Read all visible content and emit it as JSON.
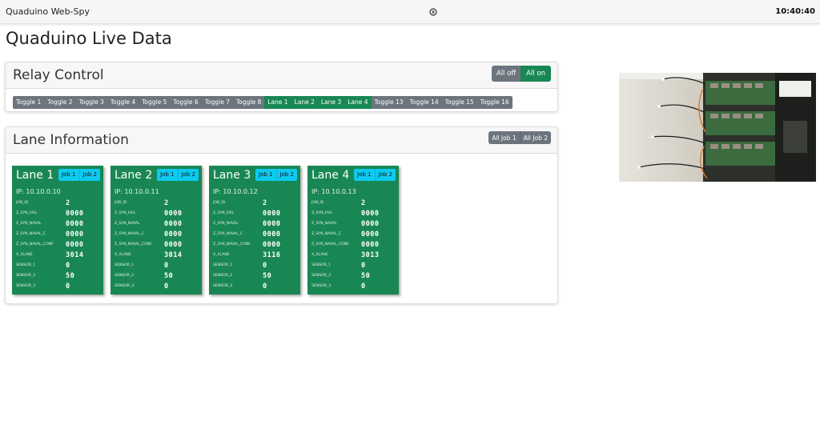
{
  "topbar": {
    "title": "Quaduino Web-Spy",
    "clock": "10:40:40"
  },
  "page": {
    "title": "Quaduino Live Data"
  },
  "relay": {
    "title": "Relay Control",
    "all_off": "All off",
    "all_on": "All on",
    "toggles": [
      {
        "label": "Toggle 1",
        "state": "off"
      },
      {
        "label": "Toggle 2",
        "state": "off"
      },
      {
        "label": "Toggle 3",
        "state": "off"
      },
      {
        "label": "Toggle 4",
        "state": "off"
      },
      {
        "label": "Toggle 5",
        "state": "off"
      },
      {
        "label": "Toggle 6",
        "state": "off"
      },
      {
        "label": "Toggle 7",
        "state": "off"
      },
      {
        "label": "Toggle 8",
        "state": "off"
      },
      {
        "label": "Lane 1",
        "state": "on"
      },
      {
        "label": "Lane 2",
        "state": "on"
      },
      {
        "label": "Lane 3",
        "state": "on"
      },
      {
        "label": "Lane 4",
        "state": "on"
      },
      {
        "label": "Toggle 13",
        "state": "off"
      },
      {
        "label": "Toggle 14",
        "state": "off"
      },
      {
        "label": "Toggle 15",
        "state": "off"
      },
      {
        "label": "Toggle 16",
        "state": "off"
      }
    ]
  },
  "lanes_panel": {
    "title": "Lane Information",
    "all_job1": "All Job 1",
    "all_job2": "All Job 2",
    "job1_label": "Job 1",
    "job2_label": "Job 2",
    "lanes": [
      {
        "title": "Lane 1",
        "ip": "IP: 10.10.0.10",
        "fields": [
          {
            "k": "JOB_ID",
            "v": "2"
          },
          {
            "k": "Z_SYN_FAIL",
            "v": "0000"
          },
          {
            "k": "Z_SYN_NAVAL",
            "v": "0000"
          },
          {
            "k": "Z_SYN_NAVAL_C",
            "v": "0000"
          },
          {
            "k": "Z_SYN_NAVAL_CONF",
            "v": "0000"
          },
          {
            "k": "X_XLANE",
            "v": "3014"
          },
          {
            "k": "SENSOR_1",
            "v": "0"
          },
          {
            "k": "SENSOR_2",
            "v": "50"
          },
          {
            "k": "SENSOR_3",
            "v": "0"
          }
        ]
      },
      {
        "title": "Lane 2",
        "ip": "IP: 10.10.0.11",
        "fields": [
          {
            "k": "JOB_ID",
            "v": "2"
          },
          {
            "k": "Z_SYN_FAIL",
            "v": "0000"
          },
          {
            "k": "Z_SYN_NAVAL",
            "v": "0000"
          },
          {
            "k": "Z_SYN_NAVAL_C",
            "v": "0000"
          },
          {
            "k": "Z_SYN_NAVAL_CONF",
            "v": "0000"
          },
          {
            "k": "X_XLANE",
            "v": "3014"
          },
          {
            "k": "SENSOR_1",
            "v": "0"
          },
          {
            "k": "SENSOR_2",
            "v": "50"
          },
          {
            "k": "SENSOR_3",
            "v": "0"
          }
        ]
      },
      {
        "title": "Lane 3",
        "ip": "IP: 10.10.0.12",
        "fields": [
          {
            "k": "JOB_ID",
            "v": "2"
          },
          {
            "k": "Z_SYN_FAIL",
            "v": "0000"
          },
          {
            "k": "Z_SYN_NAVAL",
            "v": "0000"
          },
          {
            "k": "Z_SYN_NAVAL_C",
            "v": "0000"
          },
          {
            "k": "Z_SYN_NAVAL_CONF",
            "v": "0000"
          },
          {
            "k": "X_XLANE",
            "v": "3116"
          },
          {
            "k": "SENSOR_1",
            "v": "0"
          },
          {
            "k": "SENSOR_2",
            "v": "50"
          },
          {
            "k": "SENSOR_3",
            "v": "0"
          }
        ]
      },
      {
        "title": "Lane 4",
        "ip": "IP: 10.10.0.13",
        "fields": [
          {
            "k": "JOB_ID",
            "v": "2"
          },
          {
            "k": "Z_SYN_FAIL",
            "v": "0000"
          },
          {
            "k": "Z_SYN_NAVAL",
            "v": "0000"
          },
          {
            "k": "Z_SYN_NAVAL_C",
            "v": "0000"
          },
          {
            "k": "Z_SYN_NAVAL_CONF",
            "v": "0000"
          },
          {
            "k": "X_XLANE",
            "v": "3013"
          },
          {
            "k": "SENSOR_1",
            "v": "0"
          },
          {
            "k": "SENSOR_2",
            "v": "50"
          },
          {
            "k": "SENSOR_3",
            "v": "0"
          }
        ]
      }
    ]
  },
  "colors": {
    "success": "#198754",
    "secondary": "#6c757d",
    "info": "#0dcaf0"
  },
  "icons": {
    "center": "activity-indicator-icon"
  }
}
